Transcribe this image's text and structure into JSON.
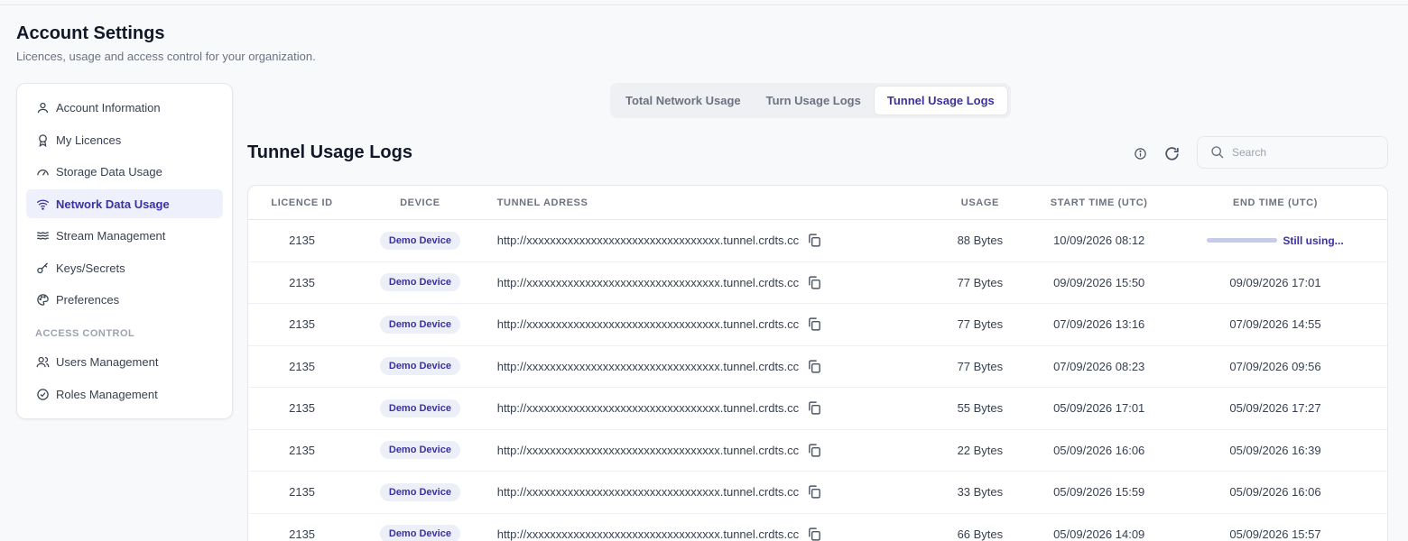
{
  "page": {
    "title": "Account Settings",
    "subtitle": "Licences, usage and access control for your organization."
  },
  "sidebar": {
    "items": [
      {
        "label": "Account Information",
        "icon": "user-icon"
      },
      {
        "label": "My Licences",
        "icon": "award-icon"
      },
      {
        "label": "Storage Data Usage",
        "icon": "gauge-icon"
      },
      {
        "label": "Network Data Usage",
        "icon": "wifi-icon",
        "active": true
      },
      {
        "label": "Stream Management",
        "icon": "waves-icon"
      },
      {
        "label": "Keys/Secrets",
        "icon": "key-icon"
      },
      {
        "label": "Preferences",
        "icon": "palette-icon"
      }
    ],
    "section_label": "ACCESS CONTROL",
    "access_items": [
      {
        "label": "Users Management",
        "icon": "users-icon"
      },
      {
        "label": "Roles Management",
        "icon": "check-circle-icon"
      }
    ]
  },
  "tabs": [
    {
      "label": "Total Network Usage"
    },
    {
      "label": "Turn Usage Logs"
    },
    {
      "label": "Tunnel Usage Logs",
      "active": true
    }
  ],
  "section": {
    "title": "Tunnel Usage Logs",
    "search_placeholder": "Search"
  },
  "table": {
    "headers": [
      "LICENCE ID",
      "DEVICE",
      "TUNNEL ADRESS",
      "USAGE",
      "START TIME (UTC)",
      "END TIME (UTC)"
    ],
    "rows": [
      {
        "licence": "2135",
        "device": "Demo Device",
        "address": "http://xxxxxxxxxxxxxxxxxxxxxxxxxxxxxxxxx.tunnel.crdts.cc",
        "usage": "88 Bytes",
        "start": "10/09/2026 08:12",
        "end": "Still using..."
      },
      {
        "licence": "2135",
        "device": "Demo Device",
        "address": "http://xxxxxxxxxxxxxxxxxxxxxxxxxxxxxxxxx.tunnel.crdts.cc",
        "usage": "77 Bytes",
        "start": "09/09/2026 15:50",
        "end": "09/09/2026 17:01"
      },
      {
        "licence": "2135",
        "device": "Demo Device",
        "address": "http://xxxxxxxxxxxxxxxxxxxxxxxxxxxxxxxxx.tunnel.crdts.cc",
        "usage": "77 Bytes",
        "start": "07/09/2026 13:16",
        "end": "07/09/2026 14:55"
      },
      {
        "licence": "2135",
        "device": "Demo Device",
        "address": "http://xxxxxxxxxxxxxxxxxxxxxxxxxxxxxxxxx.tunnel.crdts.cc",
        "usage": "77 Bytes",
        "start": "07/09/2026 08:23",
        "end": "07/09/2026 09:56"
      },
      {
        "licence": "2135",
        "device": "Demo Device",
        "address": "http://xxxxxxxxxxxxxxxxxxxxxxxxxxxxxxxxx.tunnel.crdts.cc",
        "usage": "55 Bytes",
        "start": "05/09/2026 17:01",
        "end": "05/09/2026 17:27"
      },
      {
        "licence": "2135",
        "device": "Demo Device",
        "address": "http://xxxxxxxxxxxxxxxxxxxxxxxxxxxxxxxxx.tunnel.crdts.cc",
        "usage": "22 Bytes",
        "start": "05/09/2026 16:06",
        "end": "05/09/2026 16:39"
      },
      {
        "licence": "2135",
        "device": "Demo Device",
        "address": "http://xxxxxxxxxxxxxxxxxxxxxxxxxxxxxxxxx.tunnel.crdts.cc",
        "usage": "33 Bytes",
        "start": "05/09/2026 15:59",
        "end": "05/09/2026 16:06"
      },
      {
        "licence": "2135",
        "device": "Demo Device",
        "address": "http://xxxxxxxxxxxxxxxxxxxxxxxxxxxxxxxxx.tunnel.crdts.cc",
        "usage": "66 Bytes",
        "start": "05/09/2026 14:09",
        "end": "05/09/2026 15:57"
      }
    ]
  },
  "colors": {
    "accent": "#3b32a0",
    "active_bg": "#eef0fb",
    "badge_bg": "#eceef8"
  }
}
